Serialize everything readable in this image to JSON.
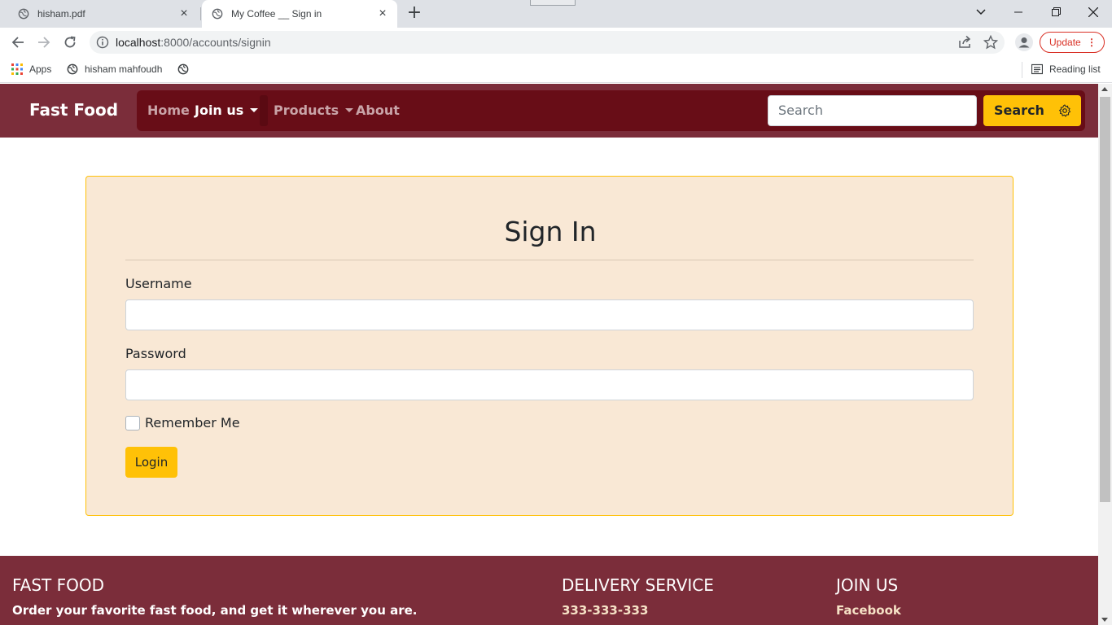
{
  "browser": {
    "tabs": [
      {
        "title": "hisham.pdf",
        "active": false
      },
      {
        "title": "My Coffee __ Sign in",
        "active": true
      }
    ],
    "url_host": "localhost",
    "url_path": ":8000/accounts/signin",
    "update_label": "Update",
    "bookmarks": [
      {
        "label": "Apps",
        "icon": "apps-grid-icon"
      },
      {
        "label": "hisham mahfoudh",
        "icon": "globe-icon"
      }
    ],
    "reading_list_label": "Reading list"
  },
  "navbar": {
    "brand": "Fast Food",
    "links": [
      {
        "label": "Home",
        "dropdown": false,
        "active": false
      },
      {
        "label": "Join us",
        "dropdown": true,
        "active": true
      },
      {
        "label": "Products",
        "dropdown": true,
        "active": false
      },
      {
        "label": "About",
        "dropdown": false,
        "active": false
      }
    ],
    "search_placeholder": "Search",
    "search_button": "Search"
  },
  "signin": {
    "title": "Sign In",
    "username_label": "Username",
    "username_value": "",
    "password_label": "Password",
    "password_value": "",
    "remember_label": "Remember Me",
    "remember_checked": false,
    "login_button": "Login"
  },
  "footer": {
    "col1": {
      "heading": "FAST FOOD",
      "text": "Order your favorite fast food, and get it wherever you are."
    },
    "col2": {
      "heading": "DELIVERY SERVICE",
      "text": "333-333-333"
    },
    "col3": {
      "heading": "JOIN US",
      "text": "Facebook"
    }
  },
  "colors": {
    "navbar_bg": "#7b2d3a",
    "nav_inner_bg": "#680d17",
    "accent_yellow": "#ffc107",
    "card_bg": "#f9e8d5"
  }
}
